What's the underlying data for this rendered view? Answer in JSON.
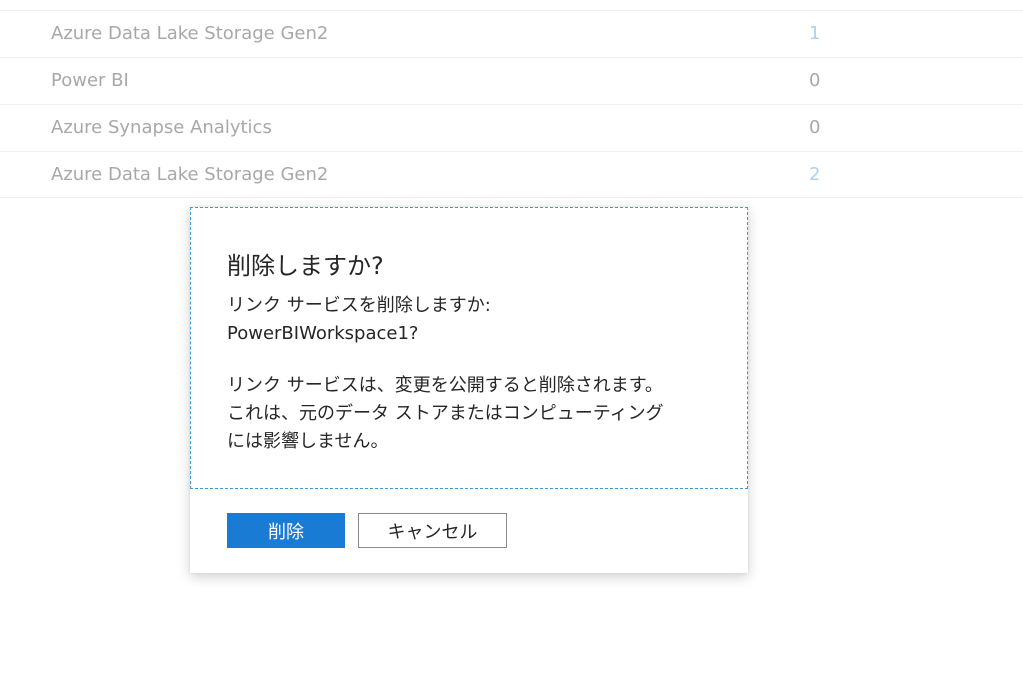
{
  "table": {
    "rows": [
      {
        "name": "Azure Data Lake Storage Gen2",
        "count": "1"
      },
      {
        "name": "Power BI",
        "count": "0"
      },
      {
        "name": "Azure Synapse Analytics",
        "count": "0"
      },
      {
        "name": "Azure Data Lake Storage Gen2",
        "count": "2"
      }
    ]
  },
  "dialog": {
    "title": "削除しますか?",
    "message_line1": "リンク サービスを削除しますか:",
    "message_line2": "PowerBIWorkspace1?",
    "note_line1": "リンク サービスは、変更を公開すると削除されます。",
    "note_line2": "これは、元のデータ ストアまたはコンピューティング",
    "note_line3": "には影響しません。",
    "delete_label": "削除",
    "cancel_label": "キャンセル"
  },
  "colors": {
    "primary": "#1a7bd5",
    "focus_border": "#3d9bd6",
    "link_count": "#a9d4ec"
  }
}
